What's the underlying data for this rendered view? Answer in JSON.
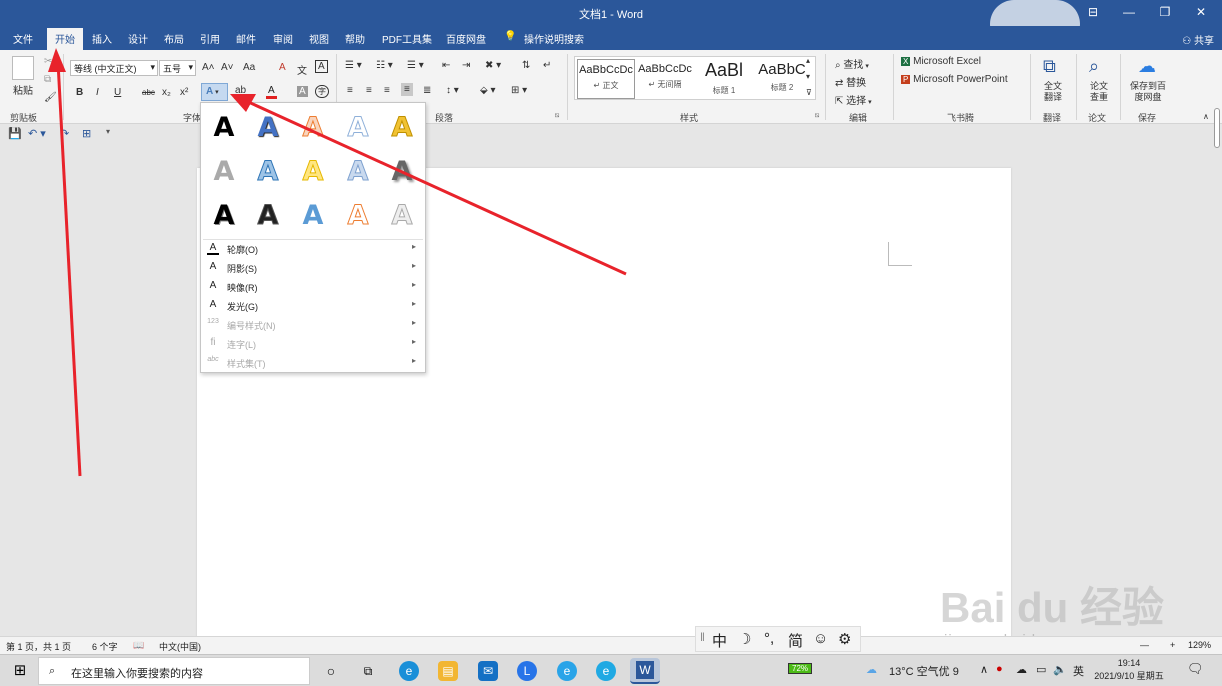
{
  "window": {
    "title": "文档1 - Word",
    "buttons": {
      "ribbon_options": "⊟",
      "minimize": "—",
      "restore": "❐",
      "close": "✕"
    }
  },
  "tabs": [
    "文件",
    "开始",
    "插入",
    "设计",
    "布局",
    "引用",
    "邮件",
    "审阅",
    "视图",
    "帮助",
    "PDF工具集",
    "百度网盘"
  ],
  "active_tab": "开始",
  "tell_me": "操作说明搜索",
  "share": "共享",
  "ribbon": {
    "clipboard": {
      "paste": "粘贴",
      "label": "剪贴板"
    },
    "font": {
      "name": "等线 (中文正文)",
      "size": "五号",
      "label": "字体",
      "b": "B",
      "i": "I",
      "u": "U",
      "strike": "abc",
      "sub": "x₂",
      "sup": "x²",
      "grow": "A˄",
      "shrink": "A˅",
      "case": "Aa",
      "clear": "A",
      "phonetic": "文",
      "border_char": "A",
      "effects": "A",
      "highlight": "ab",
      "color": "A",
      "shading": "A",
      "enclose": "字"
    },
    "paragraph": {
      "label": "段落"
    },
    "styles": {
      "label": "样式",
      "items": [
        {
          "preview": "AaBbCcDc",
          "name": "↵ 正文"
        },
        {
          "preview": "AaBbCcDc",
          "name": "↵ 无间隔"
        },
        {
          "preview": "AaBl",
          "name": "标题 1"
        },
        {
          "preview": "AaBbC",
          "name": "标题 2"
        }
      ]
    },
    "editing": {
      "find": "查找",
      "replace": "替换",
      "select": "选择",
      "label": "编辑"
    },
    "feishou": {
      "excel": "Microsoft Excel",
      "ppt": "Microsoft PowerPoint",
      "label": "飞书腾"
    },
    "translate": {
      "btn": "全文翻译",
      "label": "翻译"
    },
    "paper": {
      "btn": "论文查重",
      "label": "论文"
    },
    "save": {
      "btn": "保存到百度网盘",
      "label": "保存"
    }
  },
  "effects_menu": {
    "gallery_letter": "A",
    "items": [
      {
        "icon": "A",
        "label": "轮廓(O)",
        "enabled": true
      },
      {
        "icon": "A",
        "label": "阴影(S)",
        "enabled": true
      },
      {
        "icon": "A",
        "label": "映像(R)",
        "enabled": true
      },
      {
        "icon": "A",
        "label": "发光(G)",
        "enabled": true
      },
      {
        "icon": "123",
        "label": "编号样式(N)",
        "enabled": false
      },
      {
        "icon": "fi",
        "label": "连字(L)",
        "enabled": false
      },
      {
        "icon": "abc",
        "label": "样式集(T)",
        "enabled": false
      }
    ]
  },
  "status": {
    "page": "第 1 页，共 1 页",
    "words": "6 个字",
    "lang": "中文(中国)",
    "zoom": "129%",
    "minus": "—",
    "plus": "+"
  },
  "ime": {
    "mode": "中",
    "moon": "☽",
    "punct": "°,",
    "simp": "简",
    "emoji": "☺",
    "settings": "⚙"
  },
  "watermark": {
    "main": "Bai du 经验",
    "sub": "jingyan.baidu.com"
  },
  "taskbar": {
    "search_placeholder": "在这里输入你要搜索的内容",
    "battery": "72%",
    "weather": "13°C 空气优 9",
    "ime_lang": "英",
    "time": "19:14",
    "date": "2021/9/10 星期五"
  },
  "colors": {
    "word_blue": "#2b579a",
    "arrow_red": "#e8232b"
  }
}
